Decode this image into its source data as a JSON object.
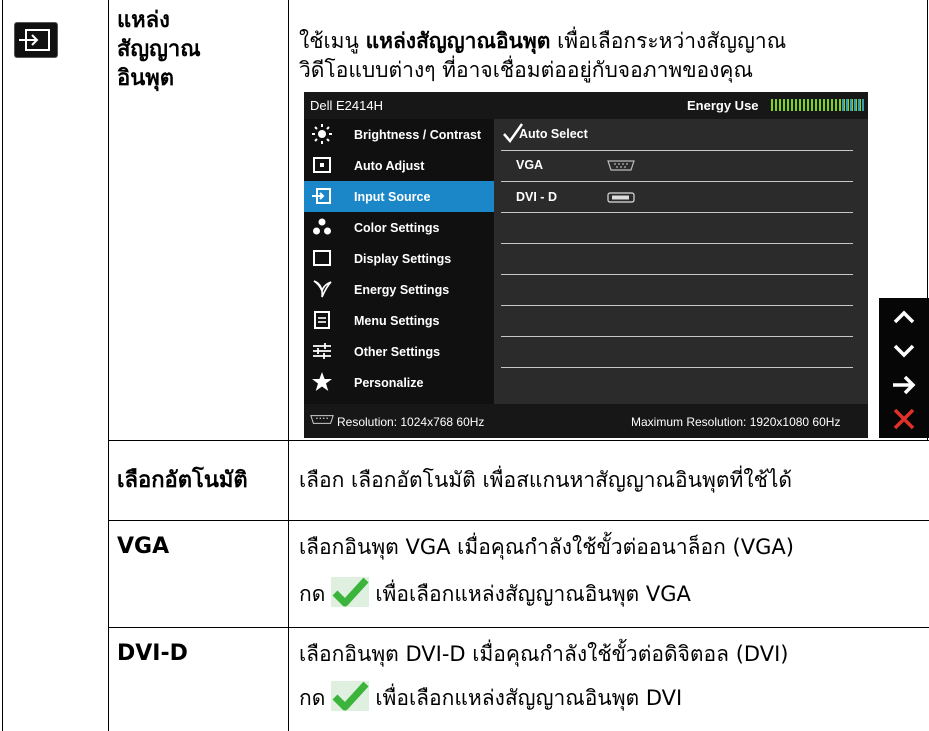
{
  "row_input_source": {
    "icon": "input-source-icon",
    "heading_lines": [
      "แหล่ง",
      "สัญญาณ",
      "อินพุต"
    ],
    "desc_line1_pre": "ใช้เมนู ",
    "desc_line1_bold": "แหล่งสัญญาณอินพุต",
    "desc_line1_post": " เพื่อเลือกระหว่างสัญญาณ",
    "desc_line2": "วิดีโอแบบต่างๆ ที่อาจเชื่อมต่ออยู่กับจอภาพของคุณ"
  },
  "osd": {
    "model": "Dell E2414H",
    "energy_label": "Energy Use",
    "menu": [
      {
        "label": "Brightness / Contrast",
        "icon": "brightness-icon"
      },
      {
        "label": "Auto Adjust",
        "icon": "auto-adjust-icon"
      },
      {
        "label": "Input Source",
        "icon": "input-source-icon",
        "selected": true
      },
      {
        "label": "Color Settings",
        "icon": "color-settings-icon"
      },
      {
        "label": "Display Settings",
        "icon": "display-settings-icon"
      },
      {
        "label": "Energy Settings",
        "icon": "energy-leaf-icon"
      },
      {
        "label": "Menu Settings",
        "icon": "menu-settings-icon"
      },
      {
        "label": "Other Settings",
        "icon": "other-settings-icon"
      },
      {
        "label": "Personalize",
        "icon": "star-icon"
      }
    ],
    "options": {
      "auto_select": "Auto Select",
      "vga": "VGA",
      "dvi": "DVI - D"
    },
    "resolution": "Resolution: 1024x768 60Hz",
    "max_resolution": "Maximum Resolution: 1920x1080 60Hz",
    "nav_buttons": [
      "up-arrow-icon",
      "down-arrow-icon",
      "right-arrow-icon",
      "close-x-icon"
    ],
    "colors": {
      "selected": "#1b87c9",
      "energy": "#7fd320",
      "close": "#e0302a"
    }
  },
  "row_auto": {
    "heading": "เลือกอัตโนมัติ",
    "desc": "เลือก เลือกอัตโนมัติ เพื่อสแกนหาสัญญาณอินพุตที่ใช้ได้"
  },
  "row_vga": {
    "heading": "VGA",
    "desc_line1": "เลือกอินพุต VGA เมื่อคุณกำลังใช้ขั้วต่ออนาล็อก (VGA)",
    "press": "กด",
    "desc_line2_post": "เพื่อเลือกแหล่งสัญญาณอินพุต VGA",
    "check_icon": "green-check-icon"
  },
  "row_dvi": {
    "heading": "DVI-D",
    "desc_line1": "เลือกอินพุต DVI-D เมื่อคุณกำลังใช้ขั้วต่อดิจิตอล (DVI)",
    "press": "กด",
    "desc_line2_post": "เพื่อเลือกแหล่งสัญญาณอินพุต DVI",
    "check_icon": "green-check-icon"
  }
}
